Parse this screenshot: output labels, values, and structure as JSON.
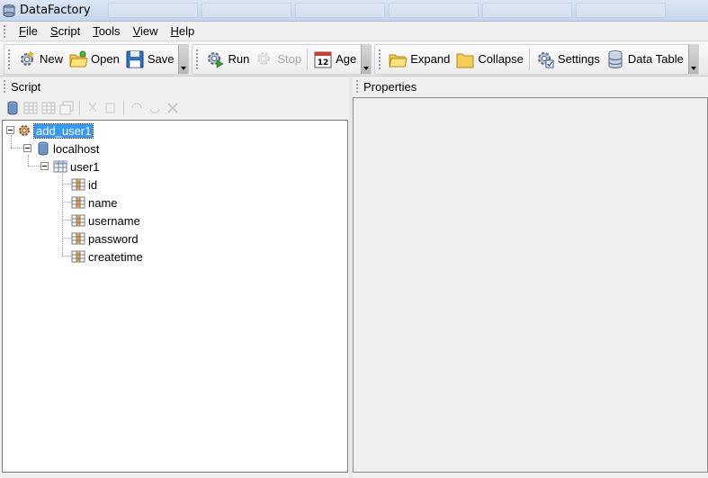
{
  "window": {
    "title": "DataFactory",
    "icon": "datafactory-app-icon"
  },
  "menu": [
    {
      "label": "File",
      "mnemonic": "F",
      "rest": "ile"
    },
    {
      "label": "Script",
      "mnemonic": "S",
      "rest": "cript"
    },
    {
      "label": "Tools",
      "mnemonic": "T",
      "rest": "ools"
    },
    {
      "label": "View",
      "mnemonic": "V",
      "rest": "iew"
    },
    {
      "label": "Help",
      "mnemonic": "H",
      "rest": "elp"
    }
  ],
  "toolbar": {
    "new": "New",
    "open": "Open",
    "save": "Save",
    "run": "Run",
    "stop": "Stop",
    "age": "Age",
    "expand": "Expand",
    "collapse": "Collapse",
    "settings": "Settings",
    "data_table": "Data Table"
  },
  "panels": {
    "script": "Script",
    "properties": "Properties"
  },
  "tree": {
    "root": "add_user1",
    "host": "localhost",
    "table": "user1",
    "columns": [
      "id",
      "name",
      "username",
      "password",
      "createtime"
    ]
  },
  "colors": {
    "selection": "#3399ff",
    "title_bar": "#c5d5ea"
  }
}
